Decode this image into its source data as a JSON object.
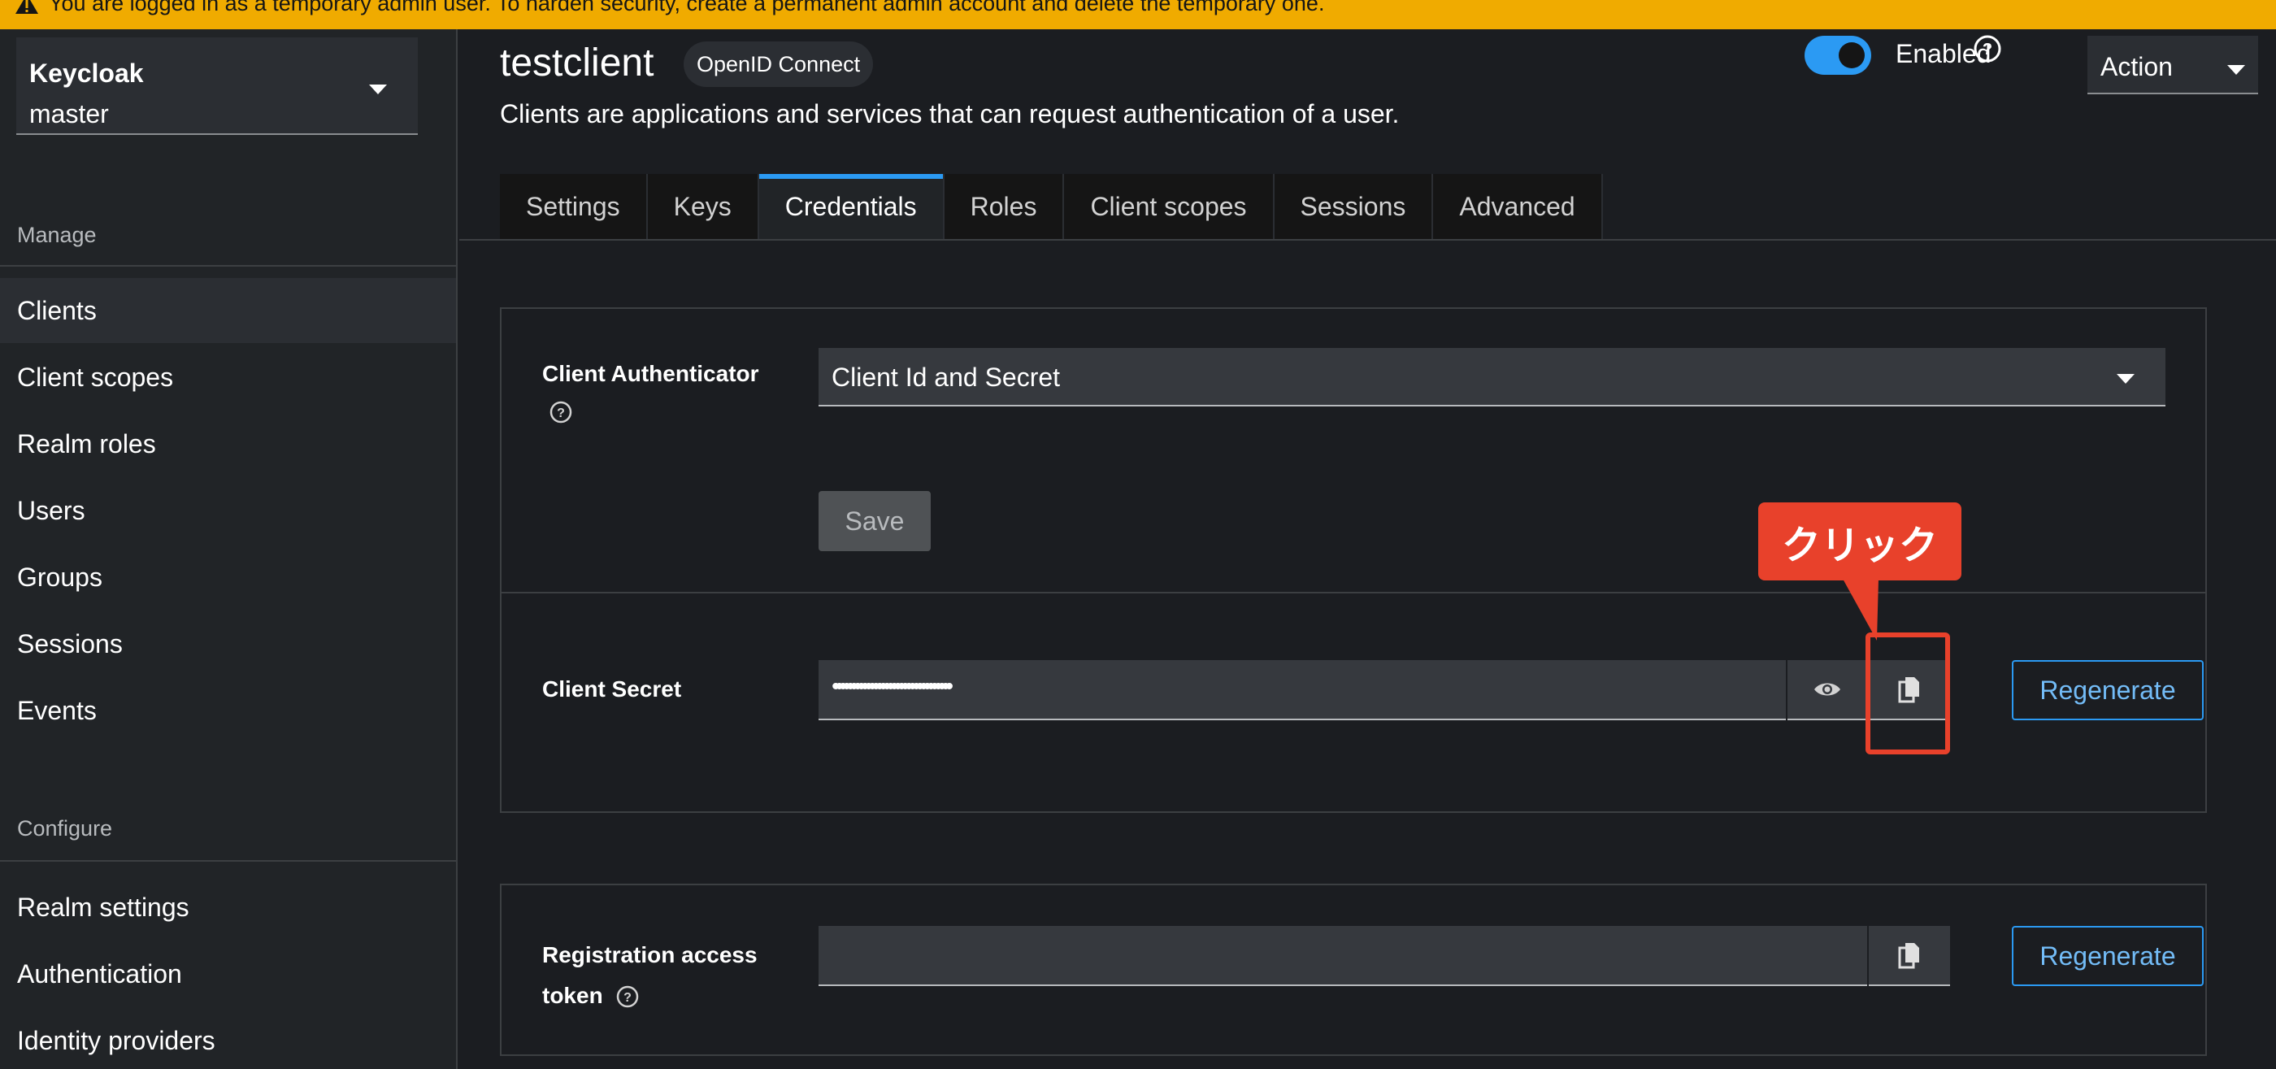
{
  "banner": {
    "text": "You are logged in as a temporary admin user. To harden security, create a permanent admin account and delete the temporary one.",
    "color": "#f0ab00"
  },
  "sidebar": {
    "realm_title": "Keycloak",
    "realm_name": "master",
    "sections": [
      {
        "label": "Manage",
        "items": [
          "Clients",
          "Client scopes",
          "Realm roles",
          "Users",
          "Groups",
          "Sessions",
          "Events"
        ]
      },
      {
        "label": "Configure",
        "items": [
          "Realm settings",
          "Authentication",
          "Identity providers"
        ]
      }
    ],
    "active_item": "Clients"
  },
  "header": {
    "title": "testclient",
    "protocol_badge": "OpenID Connect",
    "description": "Clients are applications and services that can request authentication of a user.",
    "enabled_label": "Enabled",
    "enabled": true,
    "action_label": "Action"
  },
  "tabs": [
    {
      "label": "Settings",
      "active": false
    },
    {
      "label": "Keys",
      "active": false
    },
    {
      "label": "Credentials",
      "active": true
    },
    {
      "label": "Roles",
      "active": false
    },
    {
      "label": "Client scopes",
      "active": false
    },
    {
      "label": "Sessions",
      "active": false
    },
    {
      "label": "Advanced",
      "active": false
    }
  ],
  "credentials": {
    "authenticator_label": "Client Authenticator",
    "authenticator_value": "Client Id and Secret",
    "save_label": "Save",
    "secret_label": "Client Secret",
    "secret_value": "••••••••••••••••••••••••••••••••",
    "regenerate_label": "Regenerate",
    "registration_label_line1": "Registration access",
    "registration_label_line2": "token",
    "registration_value": "",
    "regenerate2_label": "Regenerate"
  },
  "annotation": {
    "callout_text": "クリック",
    "color": "#e8412b"
  },
  "colors": {
    "accent": "#2b9af3",
    "background": "#1b1d21"
  }
}
